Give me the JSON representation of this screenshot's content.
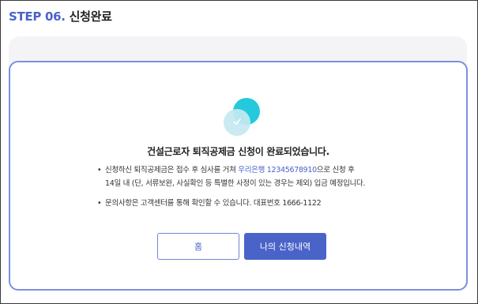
{
  "header": {
    "step_label": "STEP 06.",
    "title": "신청완료"
  },
  "completion": {
    "icon": "check-circle-icon",
    "headline": "건설근로자 퇴직공제금 신청이 완료되었습니다.",
    "notes": [
      {
        "text_before": "신청하신 퇴직공제금은 접수 후 심사를 거쳐 ",
        "highlight": "우리은행 12345678910",
        "text_after": "으로 신청 후",
        "line2": "14일 내 (단, 서류보완, 사실확인 등 특별한 사정이 있는 경우는 제외) 입금 예정입니다."
      },
      {
        "text": "문의사항은 고객센터를 통해 확인할 수 있습니다. 대표번호 1666-1122"
      }
    ]
  },
  "buttons": {
    "home_label": "홈",
    "history_label": "나의 신청내역"
  },
  "colors": {
    "accent": "#4a63c8",
    "card_border": "#7b8fe0",
    "icon_teal": "#25c9dc",
    "panel_bg": "#f4f4f6"
  }
}
